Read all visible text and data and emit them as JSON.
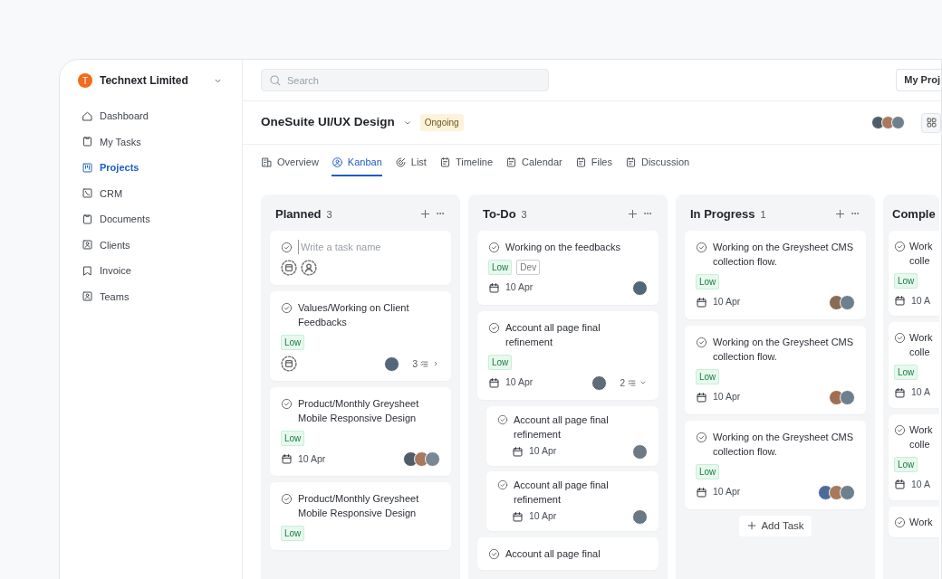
{
  "workspace": {
    "initial": "T",
    "name": "Technext Limited"
  },
  "sidebar": {
    "items": [
      {
        "label": "Dashboard",
        "selected": false
      },
      {
        "label": "My Tasks",
        "selected": false
      },
      {
        "label": "Projects",
        "selected": true
      },
      {
        "label": "CRM",
        "selected": false
      },
      {
        "label": "Documents",
        "selected": false
      },
      {
        "label": "Clients",
        "selected": false
      },
      {
        "label": "Invoice",
        "selected": false
      },
      {
        "label": "Teams",
        "selected": false
      }
    ]
  },
  "search": {
    "placeholder": "Search"
  },
  "top_button": "My Proj",
  "project": {
    "title": "OneSuite UI/UX Design",
    "status": "Ongoing",
    "members": [
      {
        "color": "#4f5d6b"
      },
      {
        "color": "#a9785e"
      },
      {
        "color": "#6e7f8e"
      }
    ]
  },
  "tabs": [
    {
      "label": "Overview",
      "selected": false
    },
    {
      "label": "Kanban",
      "selected": true
    },
    {
      "label": "List",
      "selected": false
    },
    {
      "label": "Timeline",
      "selected": false
    },
    {
      "label": "Calendar",
      "selected": false
    },
    {
      "label": "Files",
      "selected": false
    },
    {
      "label": "Discussion",
      "selected": false
    }
  ],
  "columns": [
    {
      "title": "Planned",
      "count": "3",
      "cards": [
        {
          "kind": "new",
          "placeholder": "Write a task name"
        },
        {
          "kind": "task",
          "title": "Values/Working on Client Feedbacks",
          "tags": [
            {
              "label": "Low",
              "kind": "priority"
            }
          ],
          "assignees": [
            {
              "color": "#56667a"
            }
          ],
          "subtasks": "3",
          "expanded": false
        },
        {
          "kind": "task",
          "title": "Product/Monthly Greysheet Mobile Responsive Design",
          "tags": [
            {
              "label": "Low",
              "kind": "priority"
            }
          ],
          "date": "10 Apr",
          "assignees": [
            {
              "color": "#4f5d6b"
            },
            {
              "color": "#a9785e"
            },
            {
              "color": "#7a8794"
            }
          ]
        },
        {
          "kind": "task",
          "title": "Product/Monthly Greysheet Mobile Responsive Design",
          "tags": [
            {
              "label": "Low",
              "kind": "priority"
            }
          ]
        }
      ]
    },
    {
      "title": "To-Do",
      "count": "3",
      "cards": [
        {
          "kind": "task",
          "title": "Working on the feedbacks",
          "tags": [
            {
              "label": "Low",
              "kind": "priority"
            },
            {
              "label": "Dev",
              "kind": "label"
            }
          ],
          "date": "10 Apr",
          "assignees": [
            {
              "color": "#56667a"
            }
          ]
        },
        {
          "kind": "task",
          "title": "Account all page final refinement",
          "tags": [
            {
              "label": "Low",
              "kind": "priority"
            }
          ],
          "date": "10 Apr",
          "assignees": [
            {
              "color": "#5f6b76"
            }
          ],
          "subtasks": "2",
          "expanded": true,
          "children": [
            {
              "title": "Account all page final refinement",
              "date": "10 Apr",
              "assignees": [
                {
                  "color": "#6d7a86"
                }
              ]
            },
            {
              "title": "Account all page final refinement",
              "date": "10 Apr",
              "assignees": [
                {
                  "color": "#6a7785"
                }
              ]
            }
          ]
        },
        {
          "kind": "task",
          "title": "Account all page final"
        }
      ]
    },
    {
      "title": "In Progress",
      "count": "1",
      "add_task": "Add Task",
      "cards": [
        {
          "kind": "task",
          "title": "Working on the Greysheet CMS collection flow.",
          "tags": [
            {
              "label": "Low",
              "kind": "priority"
            }
          ],
          "date": "10 Apr",
          "assignees": [
            {
              "color": "#8a6a55"
            },
            {
              "color": "#6e7f8e"
            }
          ]
        },
        {
          "kind": "task",
          "title": "Working on the Greysheet CMS collection flow.",
          "tags": [
            {
              "label": "Low",
              "kind": "priority"
            }
          ],
          "date": "10 Apr",
          "assignees": [
            {
              "color": "#a06f52"
            },
            {
              "color": "#6e7f8e"
            }
          ]
        },
        {
          "kind": "task",
          "title": "Working on the Greysheet CMS collection flow.",
          "tags": [
            {
              "label": "Low",
              "kind": "priority"
            }
          ],
          "date": "10 Apr",
          "assignees": [
            {
              "color": "#4d6b9a"
            },
            {
              "color": "#a9785e"
            },
            {
              "color": "#6e7f8e"
            }
          ]
        }
      ]
    },
    {
      "title": "Comple",
      "cards": [
        {
          "kind": "task",
          "title": "Work\ncolle",
          "tags": [
            {
              "label": "Low",
              "kind": "priority"
            }
          ],
          "date": "10 A"
        },
        {
          "kind": "task",
          "title": "Work\ncolle",
          "tags": [
            {
              "label": "Low",
              "kind": "priority"
            }
          ],
          "date": "10 A"
        },
        {
          "kind": "task",
          "title": "Work\ncolle",
          "tags": [
            {
              "label": "Low",
              "kind": "priority"
            }
          ],
          "date": "10 A"
        },
        {
          "kind": "task",
          "title": "Work"
        }
      ]
    }
  ]
}
